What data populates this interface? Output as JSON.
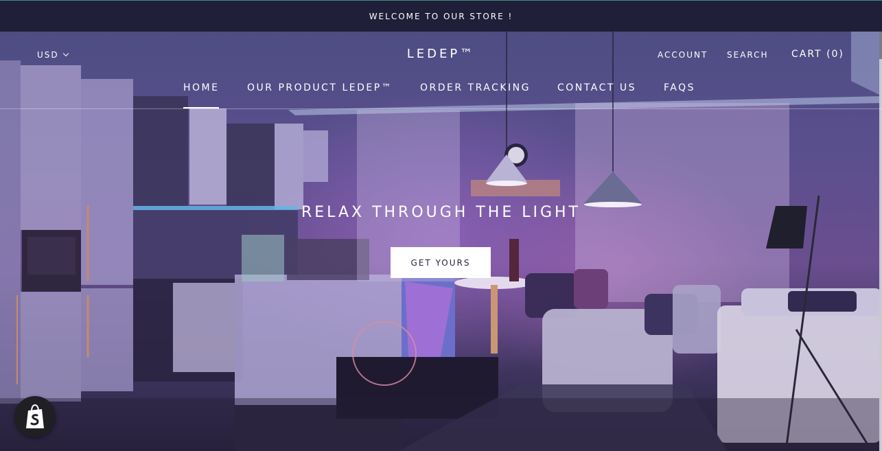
{
  "announcement": {
    "text": "WELCOME TO OUR STORE !"
  },
  "header": {
    "currency": "USD",
    "logo": "LEDEP™",
    "account": "ACCOUNT",
    "search": "SEARCH",
    "cart": "CART (0)"
  },
  "nav": {
    "items": [
      {
        "label": "HOME",
        "active": true
      },
      {
        "label": "OUR PRODUCT LEDEP™"
      },
      {
        "label": "ORDER TRACKING"
      },
      {
        "label": "CONTACT US"
      },
      {
        "label": "FAQS"
      }
    ]
  },
  "hero": {
    "title": "RELAX THROUGH THE LIGHT",
    "button": "GET YOURS"
  },
  "badge": {
    "icon": "shopify-bag-icon"
  },
  "colors": {
    "announcement_bg": "#201f3a",
    "hero_tint": "#5b4f8e",
    "button_bg": "#ffffff",
    "button_text": "#25233d"
  }
}
